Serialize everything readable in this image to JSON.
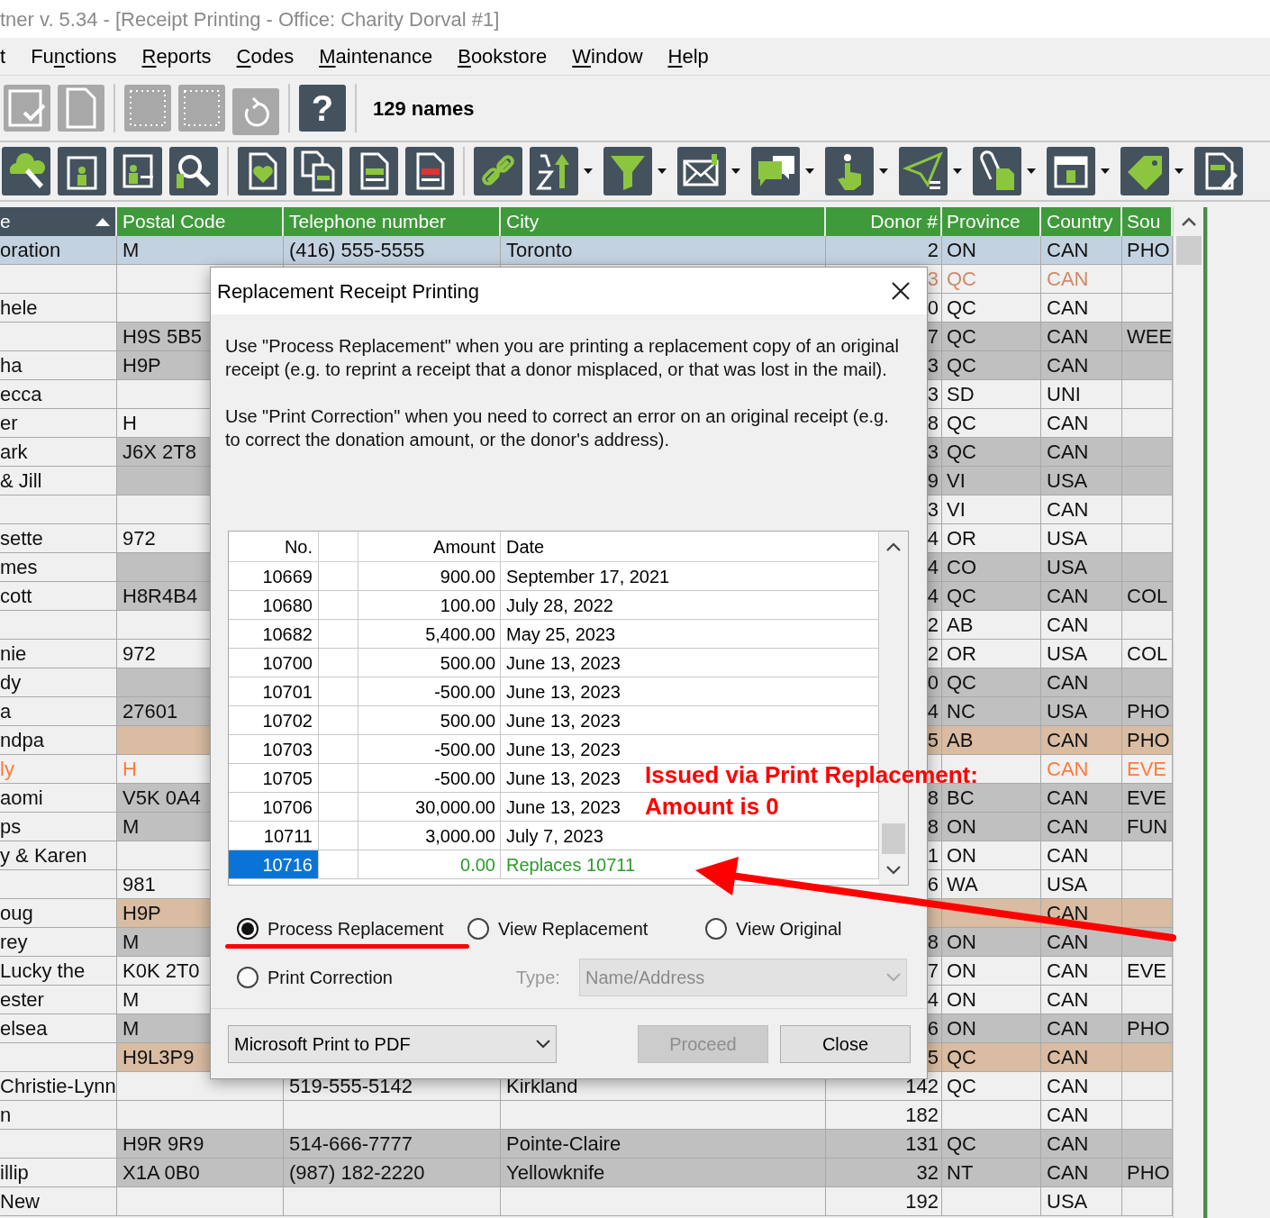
{
  "window": {
    "title": "tner v. 5.34 - [Receipt Printing - Office: Charity Dorval #1]"
  },
  "menu": [
    {
      "after": "t"
    },
    {
      "before": "Fu",
      "key": "n",
      "after": "ctions"
    },
    {
      "key": "R",
      "after": "eports"
    },
    {
      "key": "C",
      "after": "odes"
    },
    {
      "key": "M",
      "after": "aintenance"
    },
    {
      "key": "B",
      "after": "ookstore"
    },
    {
      "key": "W",
      "after": "indow"
    },
    {
      "key": "H",
      "after": "elp"
    }
  ],
  "toolbar": {
    "help": "?",
    "count": "129 names"
  },
  "grid": {
    "columns": [
      {
        "label": "e",
        "sorted": true
      },
      {
        "label": "Postal Code",
        "sorted": false
      },
      {
        "label": "Telephone number",
        "sorted": false
      },
      {
        "label": "City",
        "sorted": false
      },
      {
        "label": "Donor #",
        "sorted": false
      },
      {
        "label": "Province",
        "sorted": false
      },
      {
        "label": "Country",
        "sorted": false
      },
      {
        "label": "Sou",
        "sorted": false
      }
    ],
    "rows": [
      {
        "selected": true,
        "flagged": false,
        "name": "oration",
        "postal": "M",
        "phone": "(416) 555-5555",
        "city": "Toronto",
        "donor": "2",
        "province": "ON",
        "country": "CAN",
        "source": "PHO"
      },
      {
        "selected": false,
        "color": "#f0f0f0",
        "flagged": true,
        "donor": "3",
        "province": "QC",
        "country": "CAN"
      },
      {
        "selected": false,
        "color": "#f0f0f0",
        "flagged": false,
        "name": "hele",
        "donor": "0",
        "province": "QC",
        "country": "CAN"
      },
      {
        "selected": false,
        "color": "#c0c0c0",
        "flagged": false,
        "postal": "H9S 5B5",
        "donor": "7",
        "province": "QC",
        "country": "CAN",
        "source": "WEE"
      },
      {
        "selected": false,
        "color": "#c0c0c0",
        "flagged": false,
        "name": "ha",
        "postal": "H9P",
        "donor": "3",
        "province": "QC",
        "country": "CAN"
      },
      {
        "selected": false,
        "color": "#f0f0f0",
        "flagged": false,
        "name": "ecca",
        "donor": "3",
        "province": "SD",
        "country": "UNI"
      },
      {
        "selected": false,
        "color": "#f0f0f0",
        "flagged": false,
        "name": "er",
        "postal": "H",
        "donor": "8",
        "province": "QC",
        "country": "CAN"
      },
      {
        "selected": false,
        "color": "#c0c0c0",
        "flagged": false,
        "name": "ark",
        "postal": "J6X 2T8",
        "donor": "3",
        "province": "QC",
        "country": "CAN"
      },
      {
        "selected": false,
        "color": "#c0c0c0",
        "flagged": false,
        "name": "& Jill",
        "donor": "9",
        "province": "VI",
        "country": "USA"
      },
      {
        "selected": false,
        "color": "#f0f0f0",
        "flagged": false,
        "donor": "3",
        "province": "VI",
        "country": "CAN"
      },
      {
        "selected": false,
        "color": "#f0f0f0",
        "flagged": false,
        "name": "sette",
        "postal": "972",
        "donor": "4",
        "province": "OR",
        "country": "USA"
      },
      {
        "selected": false,
        "color": "#c0c0c0",
        "flagged": false,
        "name": "mes",
        "donor": "4",
        "province": "CO",
        "country": "USA"
      },
      {
        "selected": false,
        "color": "#c0c0c0",
        "flagged": false,
        "name": "cott",
        "postal": "H8R4B4",
        "donor": "4",
        "province": "QC",
        "country": "CAN",
        "source": "COL"
      },
      {
        "selected": false,
        "color": "#f0f0f0",
        "flagged": false,
        "donor": "2",
        "province": "AB",
        "country": "CAN"
      },
      {
        "selected": false,
        "color": "#f0f0f0",
        "flagged": false,
        "name": "nie",
        "postal": "972",
        "donor": "2",
        "province": "OR",
        "country": "USA",
        "source": "COL"
      },
      {
        "selected": false,
        "color": "#c0c0c0",
        "flagged": false,
        "name": "dy",
        "donor": "0",
        "province": "QC",
        "country": "CAN"
      },
      {
        "selected": false,
        "color": "#c0c0c0",
        "flagged": false,
        "name": "a",
        "postal": "27601",
        "donor": "4",
        "province": "NC",
        "country": "USA",
        "source": "PHO"
      },
      {
        "selected": false,
        "color": "#d9bca2",
        "flagged": false,
        "name": "ndpa",
        "donor": "5",
        "province": "AB",
        "country": "CAN",
        "source": "PHO"
      },
      {
        "selected": false,
        "color": "#f0f0f0",
        "flagged": true,
        "name": "ly",
        "postal": "H",
        "country": "CAN",
        "source": "EVE"
      },
      {
        "selected": false,
        "color": "#c0c0c0",
        "flagged": false,
        "name": "aomi",
        "postal": "V5K 0A4",
        "donor": "8",
        "province": "BC",
        "country": "CAN",
        "source": "EVE"
      },
      {
        "selected": false,
        "color": "#c0c0c0",
        "flagged": false,
        "name": "ps",
        "postal": "M",
        "donor": "8",
        "province": "ON",
        "country": "CAN",
        "source": "FUN"
      },
      {
        "selected": false,
        "color": "#f0f0f0",
        "flagged": false,
        "name": "y & Karen",
        "donor": "1",
        "province": "ON",
        "country": "CAN"
      },
      {
        "selected": false,
        "color": "#f0f0f0",
        "flagged": false,
        "postal": "981",
        "donor": "6",
        "province": "WA",
        "country": "USA"
      },
      {
        "selected": false,
        "color": "#d9bca2",
        "flagged": false,
        "name": "oug",
        "postal": "H9P",
        "country": "CAN"
      },
      {
        "selected": false,
        "color": "#c0c0c0",
        "flagged": false,
        "name": "rey",
        "postal": "M",
        "donor": "8",
        "province": "ON",
        "country": "CAN"
      },
      {
        "selected": false,
        "color": "#f0f0f0",
        "flagged": false,
        "name": "Lucky the",
        "postal": "K0K 2T0",
        "donor": "7",
        "province": "ON",
        "country": "CAN",
        "source": "EVE"
      },
      {
        "selected": false,
        "color": "#f0f0f0",
        "flagged": false,
        "name": "ester",
        "postal": "M",
        "donor": "4",
        "province": "ON",
        "country": "CAN"
      },
      {
        "selected": false,
        "color": "#c0c0c0",
        "flagged": false,
        "name": "elsea",
        "postal": "M",
        "donor": "6",
        "province": "ON",
        "country": "CAN",
        "source": "PHO"
      },
      {
        "selected": false,
        "color": "#d9bca2",
        "flagged": false,
        "postal": "H9L3P9",
        "donor": "5",
        "province": "QC",
        "country": "CAN"
      },
      {
        "selected": false,
        "color": "#f0f0f0",
        "flagged": false,
        "name": "Christie-Lynn",
        "phone": "519-555-5142",
        "city": "Kirkland",
        "donor": "142",
        "province": "QC",
        "country": "CAN"
      },
      {
        "selected": false,
        "color": "#f0f0f0",
        "flagged": false,
        "name": "n",
        "donor": "182",
        "country": "CAN"
      },
      {
        "selected": false,
        "color": "#c0c0c0",
        "flagged": false,
        "postal": "H9R 9R9",
        "phone": "514-666-7777",
        "city": "Pointe-Claire",
        "donor": "131",
        "province": "QC",
        "country": "CAN"
      },
      {
        "selected": false,
        "color": "#c0c0c0",
        "flagged": false,
        "name": "illip",
        "postal": "X1A 0B0",
        "phone": "(987) 182-2220",
        "city": "Yellowknife",
        "donor": "32",
        "province": "NT",
        "country": "CAN",
        "source": "PHO"
      },
      {
        "selected": false,
        "color": "#f0f0f0",
        "flagged": false,
        "name": "New",
        "donor": "192",
        "country": "USA"
      }
    ]
  },
  "dialog": {
    "title": "Replacement Receipt Printing",
    "paragraphs": [
      "Use \"Process Replacement\" when you are printing a replacement copy of an original receipt (e.g. to reprint a receipt that a donor misplaced, or that was lost in the mail).",
      "Use \"Print Correction\" when you need to correct an error on an original receipt (e.g. to correct the donation amount, or the donor's address)."
    ],
    "list": {
      "columns": [
        "No.",
        "Amount",
        "Date"
      ],
      "rows": [
        {
          "kind": "receipt",
          "selected": false,
          "no": "10669",
          "amount": "900.00",
          "date": "September 17, 2021"
        },
        {
          "kind": "receipt",
          "selected": false,
          "no": "10680",
          "amount": "100.00",
          "date": "July 28, 2022"
        },
        {
          "kind": "receipt",
          "selected": false,
          "no": "10682",
          "amount": "5,400.00",
          "date": "May 25, 2023"
        },
        {
          "kind": "receipt",
          "selected": false,
          "no": "10700",
          "amount": "500.00",
          "date": "June 13, 2023"
        },
        {
          "kind": "receipt",
          "selected": false,
          "no": "10701",
          "amount": "-500.00",
          "date": "June 13, 2023"
        },
        {
          "kind": "receipt",
          "selected": false,
          "no": "10702",
          "amount": "500.00",
          "date": "June 13, 2023"
        },
        {
          "kind": "receipt",
          "selected": false,
          "no": "10703",
          "amount": "-500.00",
          "date": "June 13, 2023"
        },
        {
          "kind": "receipt",
          "selected": false,
          "no": "10705",
          "amount": "-500.00",
          "date": "June 13, 2023"
        },
        {
          "kind": "receipt",
          "selected": false,
          "no": "10706",
          "amount": "30,000.00",
          "date": "June 13, 2023"
        },
        {
          "kind": "receipt",
          "selected": false,
          "no": "10711",
          "amount": "3,000.00",
          "date": "July 7, 2023"
        },
        {
          "kind": "replacement",
          "selected": true,
          "no": "10716",
          "amount": "0.00",
          "date": "Replaces 10711"
        }
      ]
    },
    "options": [
      {
        "label": "Process Replacement",
        "selected": true
      },
      {
        "label": "View Replacement",
        "selected": false
      },
      {
        "label": "View Original",
        "selected": false
      },
      {
        "label": "Print Correction",
        "selected": false
      }
    ],
    "type": {
      "label": "Type:",
      "value": "Name/Address",
      "disabled": true
    },
    "printer": {
      "value": "Microsoft Print to PDF"
    },
    "buttons": [
      {
        "label": "Proceed",
        "disabled": true
      },
      {
        "label": "Close",
        "disabled": false
      }
    ]
  },
  "annotation": {
    "lines": [
      "Issued via Print Replacement:",
      "Amount is 0"
    ]
  }
}
